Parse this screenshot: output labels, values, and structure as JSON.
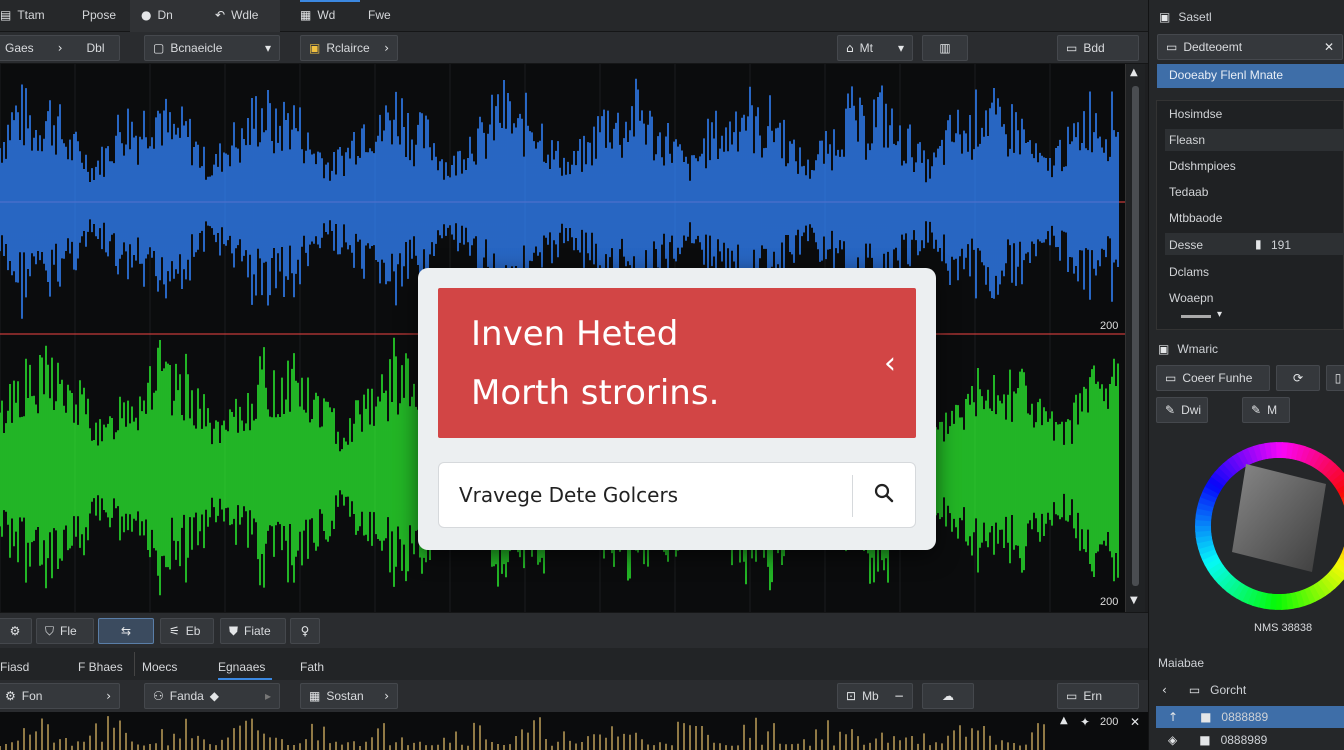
{
  "menubar": {
    "items": [
      {
        "icon": "file-icon",
        "label": "Ttam"
      },
      {
        "icon": "",
        "label": "Ppose"
      },
      {
        "icon": "dot-icon",
        "label": "Dn"
      },
      {
        "icon": "back-icon",
        "label": "Wdle"
      },
      {
        "icon": "grid-icon",
        "label": "Wd"
      },
      {
        "icon": "",
        "label": "Fwe"
      }
    ]
  },
  "toolbar": {
    "left_label": "Gaes",
    "left_btn": "Dbl",
    "dropdown": "Bcnaeicle",
    "go_label": "Rclairce",
    "view_label": "Mt",
    "slot_label": "",
    "right_label": "Bdd"
  },
  "wave": {
    "scale_top": "200",
    "scale_bottom": "200"
  },
  "dialog": {
    "title_line1": "Inven Heted",
    "title_line2": "Morth strorins.",
    "search_value": "Vravege Dete Golcers"
  },
  "bottom_toolbar": {
    "items": [
      "Fle",
      "",
      "Eb",
      "Fiate",
      ""
    ]
  },
  "bottom_menu": {
    "items": [
      "Fiasd",
      "F Bhaes",
      "Moecs",
      "Egnaaes",
      "Fath"
    ]
  },
  "bottom_toolbar2": {
    "left_label": "Fon",
    "track": "Fanda",
    "go_label": "Sostan",
    "view_label": "Mb",
    "right_label": "Ern",
    "scale": "200"
  },
  "right_panel": {
    "header": "Sasetl",
    "search": "Dedteoemt",
    "selected": "Dooeaby Flenl Mnate",
    "list": [
      "Hosimdse",
      "Fleasn",
      "Ddshmpioes",
      "Tedaab",
      "Mtbbaode",
      "Desse",
      "Dclams",
      "Woaepn"
    ],
    "list_value": "191",
    "section2": "Wmaric",
    "btn1": "Coeer Funhe",
    "btn2": "Dwi",
    "btn3": "M",
    "color_readout": "NMS 38838",
    "section3": "Maiabae",
    "nav_label": "Gorcht",
    "row1": "0888889",
    "row2": "0888989"
  }
}
